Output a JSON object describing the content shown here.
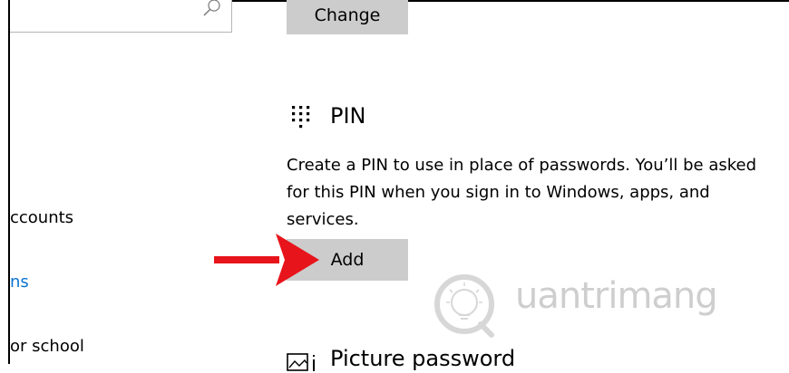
{
  "nav": {
    "items": [
      {
        "label": "ccounts",
        "type": "text"
      },
      {
        "label": "ns",
        "type": "link"
      },
      {
        "label": "or school",
        "type": "text"
      }
    ]
  },
  "password": {
    "change_label": "Change"
  },
  "pin": {
    "title": "PIN",
    "description": "Create a PIN to use in place of passwords. You’ll be asked for this PIN when you sign in to Windows, apps, and services.",
    "add_label": "Add"
  },
  "picture_password": {
    "title": "Picture password"
  },
  "watermark": {
    "text": "uantrimang",
    "logo_letter": "Q"
  },
  "colors": {
    "button_bg": "#cccccc",
    "link": "#0b74d0",
    "arrow": "#e8141b"
  },
  "icons": {
    "search": "search-icon",
    "pin": "keypad-icon",
    "picture": "picture-icon"
  }
}
